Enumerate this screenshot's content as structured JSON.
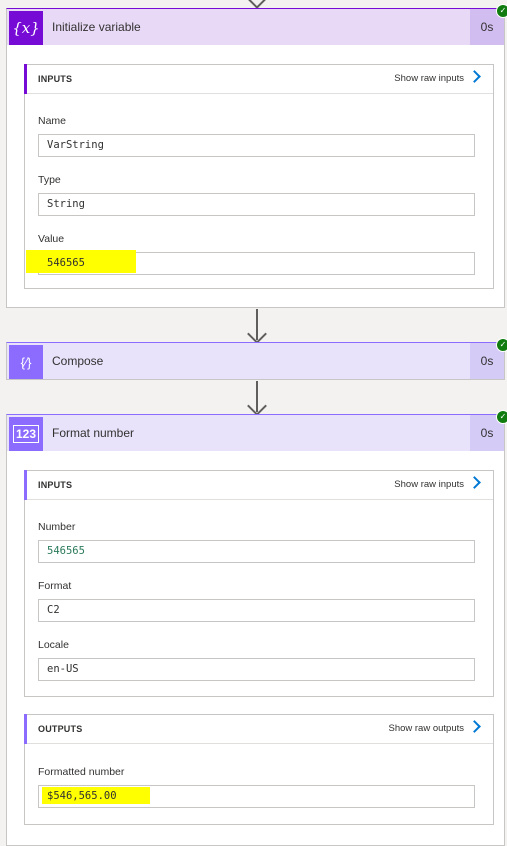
{
  "colors": {
    "variable_purple": "#770bd6",
    "compose_purple": "#8c6cff",
    "format_purple": "#8c6cff",
    "success_green": "#107c10",
    "highlight_yellow": "#ffff00",
    "link_blue": "#0078d4",
    "number_teal": "#2a7a5a"
  },
  "actions": [
    {
      "title": "Initialize variable",
      "icon": "variable-icon",
      "icon_text": "{x}",
      "duration": "0s",
      "inputs": {
        "header": "INPUTS",
        "raw_link": "Show raw inputs",
        "fields": [
          {
            "label": "Name",
            "value": "VarString"
          },
          {
            "label": "Type",
            "value": "String"
          },
          {
            "label": "Value",
            "value": "546565"
          }
        ]
      }
    },
    {
      "title": "Compose",
      "icon": "compose-icon",
      "icon_text": "{⁄}",
      "duration": "0s"
    },
    {
      "title": "Format number",
      "icon": "number-icon",
      "icon_text": "123",
      "duration": "0s",
      "inputs": {
        "header": "INPUTS",
        "raw_link": "Show raw inputs",
        "fields": [
          {
            "label": "Number",
            "value": "546565"
          },
          {
            "label": "Format",
            "value": "C2"
          },
          {
            "label": "Locale",
            "value": "en-US"
          }
        ]
      },
      "outputs": {
        "header": "OUTPUTS",
        "raw_link": "Show raw outputs",
        "fields": [
          {
            "label": "Formatted number",
            "value": "$546,565.00"
          }
        ]
      }
    }
  ]
}
